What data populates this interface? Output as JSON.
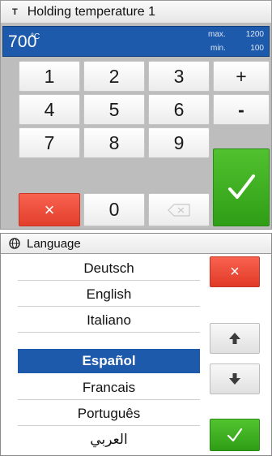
{
  "keypad": {
    "title": "Holding temperature 1",
    "title_icon": "T",
    "value": "700",
    "unit": "°C",
    "max_label": "max.",
    "max_value": "1200",
    "min_label": "min.",
    "min_value": "100",
    "keys": {
      "k1": "1",
      "k2": "2",
      "k3": "3",
      "plus": "+",
      "k4": "4",
      "k5": "5",
      "k6": "6",
      "minus": "-",
      "k7": "7",
      "k8": "8",
      "k9": "9",
      "cancel": "×",
      "k0": "0"
    },
    "icons": {
      "backspace": "backspace-icon",
      "confirm": "checkmark-icon",
      "cancel": "close-icon"
    },
    "colors": {
      "value_bar": "#1e5aab",
      "cancel": "#e8472f",
      "confirm": "#3aaa1e"
    }
  },
  "language": {
    "title": "Language",
    "title_icon": "globe-icon",
    "items": [
      {
        "label": "Deutsch"
      },
      {
        "label": "English"
      },
      {
        "label": "Italiano"
      },
      {
        "label": "Español"
      },
      {
        "label": "Francais"
      },
      {
        "label": "Português"
      },
      {
        "label": "العربي"
      }
    ],
    "selected": "Español",
    "buttons": {
      "close": "×"
    },
    "icons": {
      "close": "close-icon",
      "up": "arrow-up-icon",
      "down": "arrow-down-icon",
      "confirm": "checkmark-icon"
    }
  }
}
